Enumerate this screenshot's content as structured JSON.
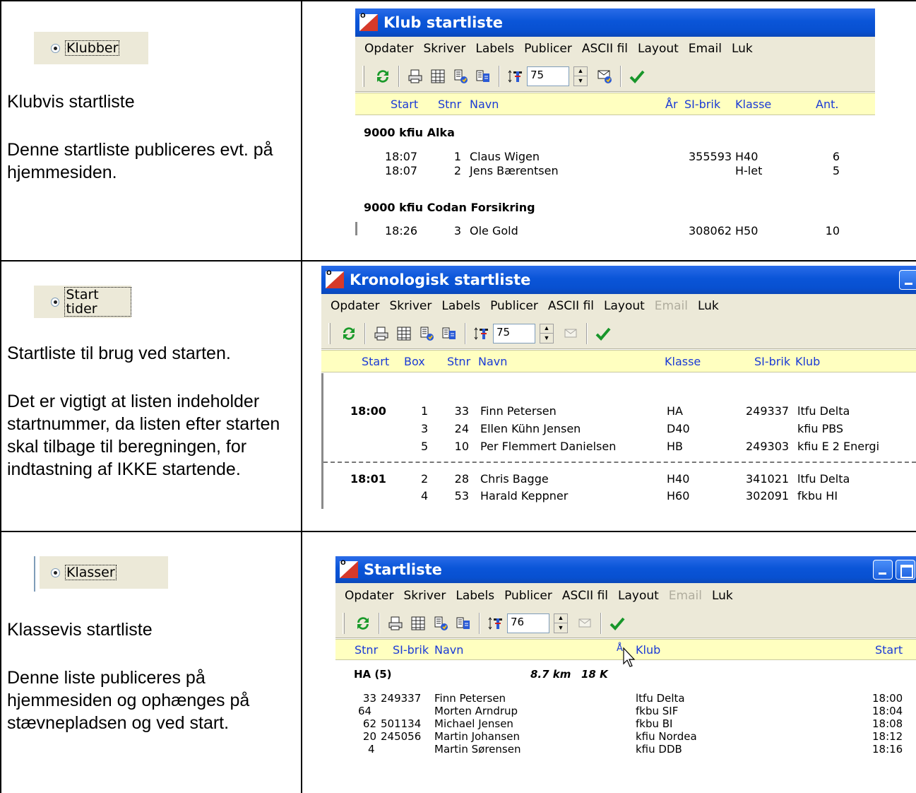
{
  "rows": [
    {
      "option_label": "Klubber",
      "description": [
        "Klubvis startliste",
        "Denne startliste publiceres evt. på hjemmesiden."
      ],
      "window": {
        "title": "Klub startliste",
        "menu": [
          "Opdater",
          "Skriver",
          "Labels",
          "Publicer",
          "ASCII fil",
          "Layout",
          "Email",
          "Luk"
        ],
        "font_size": "75",
        "columns": [
          "Start",
          "Stnr",
          "Navn",
          "År",
          "SI-brik",
          "Klasse",
          "Ant."
        ],
        "groups": [
          {
            "name": "9000  kfiu Alka",
            "rows": [
              {
                "start": "18:07",
                "stnr": "1",
                "navn": "Claus Wigen",
                "sibrik": "355593",
                "klasse": "H40",
                "ant": "6"
              },
              {
                "start": "18:07",
                "stnr": "2",
                "navn": "Jens Bærentsen",
                "sibrik": "",
                "klasse": "H-let",
                "ant": "5"
              }
            ]
          },
          {
            "name": "9000  kfiu Codan Forsikring",
            "rows": [
              {
                "start": "18:26",
                "stnr": "3",
                "navn": "Ole Gold",
                "sibrik": "308062",
                "klasse": "H50",
                "ant": "10"
              }
            ]
          }
        ]
      }
    },
    {
      "option_label": "Start tider",
      "description": [
        "Startliste til brug ved starten.",
        "Det er vigtigt at listen indeholder startnummer, da listen efter starten skal tilbage til beregningen, for indtastning af IKKE startende."
      ],
      "window": {
        "title": "Kronologisk startliste",
        "menu": [
          "Opdater",
          "Skriver",
          "Labels",
          "Publicer",
          "ASCII fil",
          "Layout",
          "Email",
          "Luk"
        ],
        "disabled_menu": "Email",
        "font_size": "75",
        "columns": [
          "Start",
          "Box",
          "Stnr",
          "Navn",
          "Klasse",
          "SI-brik",
          "Klub"
        ],
        "groups": [
          {
            "time": "18:00",
            "rows": [
              {
                "box": "1",
                "stnr": "33",
                "navn": "Finn Petersen",
                "klasse": "HA",
                "sibrik": "249337",
                "klub": "ltfu Delta"
              },
              {
                "box": "3",
                "stnr": "24",
                "navn": "Ellen Kühn Jensen",
                "klasse": "D40",
                "sibrik": "",
                "klub": "kfiu PBS"
              },
              {
                "box": "5",
                "stnr": "10",
                "navn": "Per Flemmert Danielsen",
                "klasse": "HB",
                "sibrik": "249303",
                "klub": "kfiu E 2 Energi"
              }
            ]
          },
          {
            "time": "18:01",
            "rows": [
              {
                "box": "2",
                "stnr": "28",
                "navn": "Chris Bagge",
                "klasse": "H40",
                "sibrik": "341021",
                "klub": "ltfu Delta"
              },
              {
                "box": "4",
                "stnr": "53",
                "navn": "Harald Keppner",
                "klasse": "H60",
                "sibrik": "302091",
                "klub": "fkbu HI"
              }
            ]
          }
        ]
      }
    },
    {
      "option_label": "Klasser",
      "description": [
        "Klassevis startliste",
        "Denne liste publiceres på hjemmesiden og ophænges på stævnepladsen og ved start."
      ],
      "window": {
        "title": "Startliste",
        "menu": [
          "Opdater",
          "Skriver",
          "Labels",
          "Publicer",
          "ASCII fil",
          "Layout",
          "Email",
          "Luk"
        ],
        "disabled_menu": "Email",
        "font_size": "76",
        "columns": [
          "Stnr",
          "SI-brik",
          "Navn",
          "Klub",
          "Start"
        ],
        "class_header": {
          "name": "HA  (5)",
          "distance": "8.7 km",
          "controls": "18 K"
        },
        "rows": [
          {
            "stnr": "33",
            "sibrik": "249337",
            "navn": "Finn Petersen",
            "klub": "ltfu Delta",
            "start": "18:00"
          },
          {
            "stnr": "64",
            "sibrik": "",
            "navn": "Morten Arndrup",
            "klub": "fkbu SIF",
            "start": "18:04"
          },
          {
            "stnr": "62",
            "sibrik": "501134",
            "navn": "Michael Jensen",
            "klub": "fkbu BI",
            "start": "18:08"
          },
          {
            "stnr": "20",
            "sibrik": "245056",
            "navn": "Martin Johansen",
            "klub": "kfiu Nordea",
            "start": "18:12"
          },
          {
            "stnr": "4",
            "sibrik": "",
            "navn": "Martin Sørensen",
            "klub": "kfiu DDB",
            "start": "18:16"
          }
        ]
      }
    }
  ]
}
